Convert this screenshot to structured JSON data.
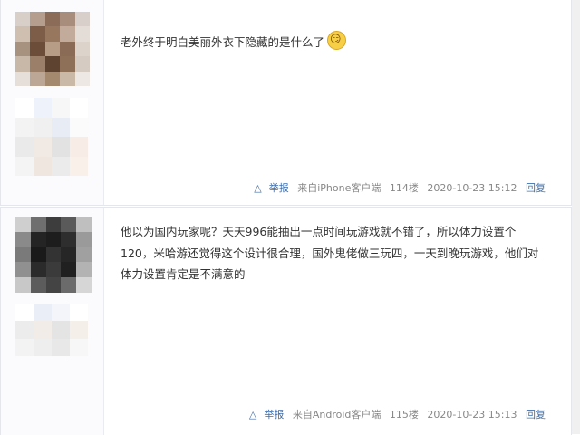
{
  "posts": [
    {
      "content": "老外终于明白美丽外衣下隐藏的是什么了",
      "emoji": "smirk-emoji",
      "report": "举报",
      "source": "来自iPhone客户端",
      "floor": "114楼",
      "timestamp": "2020-10-23 15:12",
      "reply": "回复"
    },
    {
      "content": "他以为国内玩家呢？天天996能抽出一点时间玩游戏就不错了，所以体力设置个120，米哈游还觉得这个设计很合理，国外鬼佬做三玩四，一天到晚玩游戏，他们对体力设置肯定是不满意的",
      "report": "举报",
      "source": "来自Android客户端",
      "floor": "115楼",
      "timestamp": "2020-10-23 15:13",
      "reply": "回复"
    }
  ],
  "avatar_colors": {
    "avatar1": [
      "#d8cfc8",
      "#b59e8e",
      "#8b6c58",
      "#a88d7c",
      "#d9cfca",
      "#cfbfb0",
      "#7d5c48",
      "#98775f",
      "#c2ab9a",
      "#e4dcd6",
      "#a7917f",
      "#6b4d3a",
      "#b79c86",
      "#8a6b55",
      "#dcd3cb",
      "#c8b8a8",
      "#9b7f69",
      "#5f4331",
      "#8e7059",
      "#d6cbc2",
      "#e6dfd9",
      "#bca796",
      "#a4896f",
      "#cbb9a8",
      "#ede8e3"
    ],
    "avatar2": [
      "#cfcfcf",
      "#6f6f6f",
      "#3d3d3d",
      "#5a5a5a",
      "#bfbfbf",
      "#8a8a8a",
      "#242424",
      "#1d1d1d",
      "#2e2e2e",
      "#9a9a9a",
      "#7a7a7a",
      "#1a1a1a",
      "#333333",
      "#262626",
      "#a0a0a0",
      "#909090",
      "#2b2b2b",
      "#3b3b3b",
      "#202020",
      "#b3b3b3",
      "#c8c8c8",
      "#5c5c5c",
      "#444444",
      "#6b6b6b",
      "#d6d6d6"
    ],
    "pixels1": [
      "#ffffff",
      "#eef3fb",
      "#f7f7f7",
      "#ffffff",
      "#f3f3f3",
      "#f0f0f0",
      "#e8edf5",
      "#fbfbfb",
      "#eaeaea",
      "#f1e9e4",
      "#e2e2e2",
      "#f8ece6",
      "#f4f4f4",
      "#efe6e0",
      "#ebebeb",
      "#f9f0ea"
    ],
    "pixels2": [
      "#ffffff",
      "#e9eef7",
      "#f3f5fa",
      "#ffffff",
      "#ececec",
      "#f2ece8",
      "#e4e4e4",
      "#f5efea",
      "#f3f3f3",
      "#eeeeee",
      "#e8e8e8",
      "#f7f7f7"
    ]
  }
}
